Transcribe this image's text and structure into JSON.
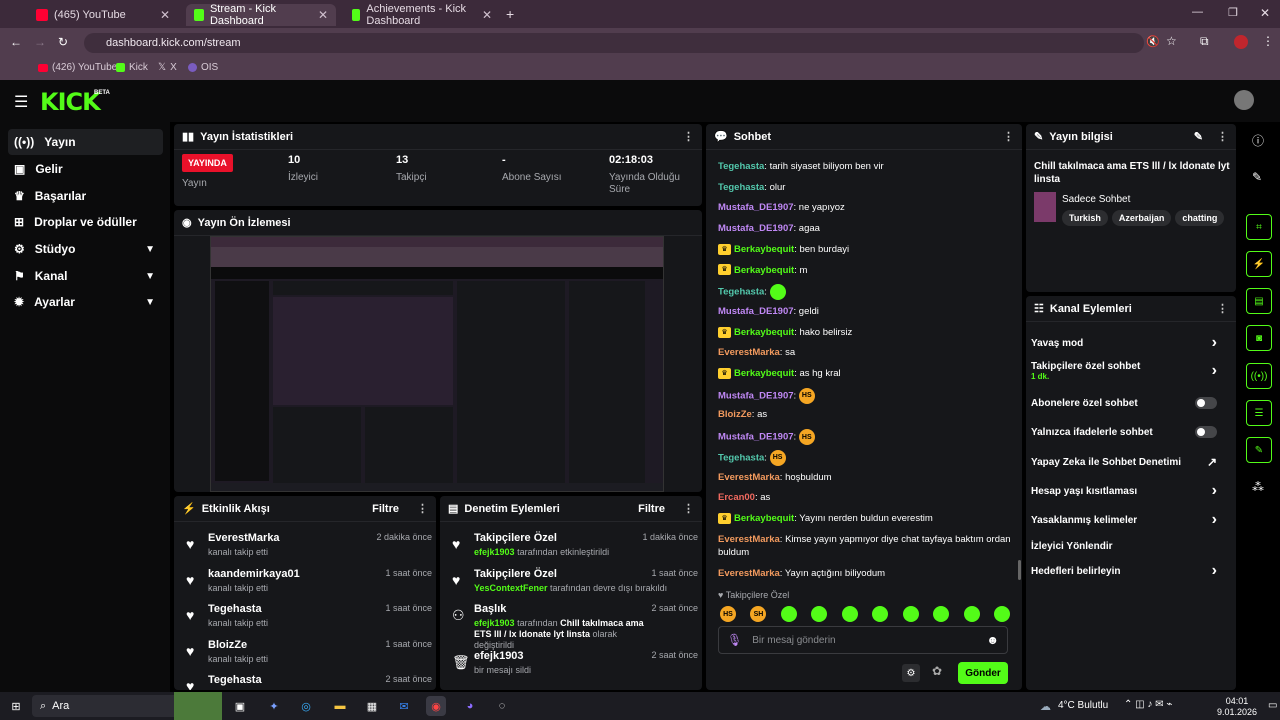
{
  "browser": {
    "tabs": [
      {
        "label": "(465) YouTube"
      },
      {
        "label": "Stream - Kick Dashboard"
      },
      {
        "label": "Achievements - Kick Dashboard"
      }
    ],
    "url": "dashboard.kick.com/stream",
    "bookmarks": [
      "(426) YouTube",
      "Kick",
      "X",
      "OIS"
    ]
  },
  "header": {
    "logo": "KICK",
    "logo_sup": "BETA"
  },
  "sidebar": {
    "items": [
      {
        "label": "Yayın",
        "icon": "broadcast-icon"
      },
      {
        "label": "Gelir",
        "icon": "dollar-icon"
      },
      {
        "label": "Başarılar",
        "icon": "trophy-icon"
      },
      {
        "label": "Droplar ve ödüller",
        "icon": "gift-icon"
      },
      {
        "label": "Stüdyo",
        "icon": "studio-icon"
      },
      {
        "label": "Kanal",
        "icon": "channel-icon"
      },
      {
        "label": "Ayarlar",
        "icon": "settings-icon"
      }
    ]
  },
  "stats": {
    "title": "Yayın İstatistikleri",
    "live_badge": "YAYINDA",
    "live_label": "Yayın",
    "viewers_value": "10",
    "viewers_label": "İzleyici",
    "followers_value": "13",
    "followers_label": "Takipçi",
    "subs_value": "-",
    "subs_label": "Abone Sayısı",
    "uptime_value": "02:18:03",
    "uptime_label": "Yayında Olduğu Süre"
  },
  "preview": {
    "title": "Yayın Ön İzlemesi"
  },
  "activity": {
    "title": "Etkinlik Akışı",
    "filter": "Filtre",
    "items": [
      {
        "name": "EverestMarka",
        "sub": "kanalı takip etti",
        "time": "2 dakika önce"
      },
      {
        "name": "kaandemirkaya01",
        "sub": "kanalı takip etti",
        "time": "1 saat önce"
      },
      {
        "name": "Tegehasta",
        "sub": "kanalı takip etti",
        "time": "1 saat önce"
      },
      {
        "name": "BloizZe",
        "sub": "kanalı takip etti",
        "time": "1 saat önce"
      },
      {
        "name": "Tegehasta",
        "sub": "",
        "time": "2 saat önce"
      }
    ]
  },
  "moderation": {
    "title": "Denetim Eylemleri",
    "filter": "Filtre",
    "items": [
      {
        "title": "Takipçilere Özel",
        "actor": "efejk1903",
        "desc": "tarafından etkinleştirildi",
        "time": "1 dakika önce"
      },
      {
        "title": "Takipçilere Özel",
        "actor": "YesContextFener",
        "desc": "tarafından devre dışı bırakıldı",
        "time": "1 saat önce"
      },
      {
        "title": "Başlık",
        "actor": "efejk1903",
        "desc": "tarafından",
        "extra": "Chill takılmaca ama ETS lll / lx ldonate lyt linsta",
        "desc2": "olarak değiştirildi",
        "time": "2 saat önce"
      },
      {
        "title": "efejk1903",
        "actor": "",
        "desc": "bir mesajı sildi",
        "time": "2 saat önce"
      }
    ]
  },
  "chat": {
    "title": "Sohbet",
    "messages": [
      {
        "user": "Tegehasta",
        "color": "teal",
        "text": "tarih siyaset biliyom ben vir"
      },
      {
        "user": "Tegehasta",
        "color": "teal",
        "text": "olur"
      },
      {
        "user": "Mustafa_DE1907",
        "color": "purple",
        "text": "ne yapıyoz"
      },
      {
        "user": "Mustafa_DE1907",
        "color": "purple",
        "text": "agaa"
      },
      {
        "user": "Berkaybequit",
        "color": "green",
        "badge": true,
        "text": "ben burdayi"
      },
      {
        "user": "Berkaybequit",
        "color": "green",
        "badge": true,
        "text": "m"
      },
      {
        "user": "Tegehasta",
        "color": "teal",
        "text": "",
        "emote": "g"
      },
      {
        "user": "Mustafa_DE1907",
        "color": "purple",
        "text": "geldi"
      },
      {
        "user": "Berkaybequit",
        "color": "green",
        "badge": true,
        "text": "hako belirsiz"
      },
      {
        "user": "EverestMarka",
        "color": "orange",
        "text": "sa"
      },
      {
        "user": "Berkaybequit",
        "color": "green",
        "badge": true,
        "text": "as hg kral"
      },
      {
        "user": "Mustafa_DE1907",
        "color": "purple",
        "text": "",
        "emote": "y"
      },
      {
        "user": "BloizZe",
        "color": "orange",
        "text": "as"
      },
      {
        "user": "Mustafa_DE1907",
        "color": "purple",
        "text": "",
        "emote": "y"
      },
      {
        "user": "Tegehasta",
        "color": "teal",
        "text": "",
        "emote": "y"
      },
      {
        "user": "EverestMarka",
        "color": "orange",
        "text": "hoşbuldum"
      },
      {
        "user": "Ercan00",
        "color": "red",
        "text": "as"
      },
      {
        "user": "Berkaybequit",
        "color": "green",
        "badge": true,
        "text": "Yayını nerden buldun everestim"
      },
      {
        "user": "EverestMarka",
        "color": "orange",
        "text": "Kimse yayın yapmıyor diye chat tayfaya baktım ordan buldum"
      },
      {
        "user": "EverestMarka",
        "color": "orange",
        "text": "Yayın açtığını biliyodum"
      }
    ],
    "mode_label": "Takipçilere Özel",
    "emote_bar": [
      "HS",
      "SH",
      "",
      "",
      "",
      "",
      "",
      "",
      "",
      ""
    ],
    "input_placeholder": "Bir mesaj gönderin",
    "send_label": "Gönder"
  },
  "info": {
    "title": "Yayın bilgisi",
    "stream_title": "Chill takılmaca ama ETS lll / lx ldonate lyt linsta",
    "category": "Sadece Sohbet",
    "tags": [
      "Turkish",
      "Azerbaijan",
      "chatting"
    ]
  },
  "channel_actions": {
    "title": "Kanal Eylemleri",
    "items": [
      {
        "label": "Yavaş mod",
        "control": "chevron"
      },
      {
        "label": "Takipçilere özel sohbet",
        "sub": "1 dk.",
        "control": "chevron"
      },
      {
        "label": "Abonelere özel sohbet",
        "control": "toggle"
      },
      {
        "label": "Yalnızca ifadelerle sohbet",
        "control": "toggle"
      },
      {
        "label": "Yapay Zeka ile Sohbet Denetimi",
        "control": "external"
      },
      {
        "label": "Hesap yaşı kısıtlaması",
        "control": "chevron"
      },
      {
        "label": "Yasaklanmış kelimeler",
        "control": "chevron"
      },
      {
        "label": "İzleyici Yönlendir",
        "control": "none"
      },
      {
        "label": "Hedefleri belirleyin",
        "control": "chevron"
      }
    ]
  },
  "taskbar": {
    "search": "Ara",
    "weather": "4°C Bulutlu",
    "time": "04:01",
    "date": "9.01.2026"
  },
  "colors": {
    "accent": "#53fc18",
    "live": "#e9112a"
  }
}
